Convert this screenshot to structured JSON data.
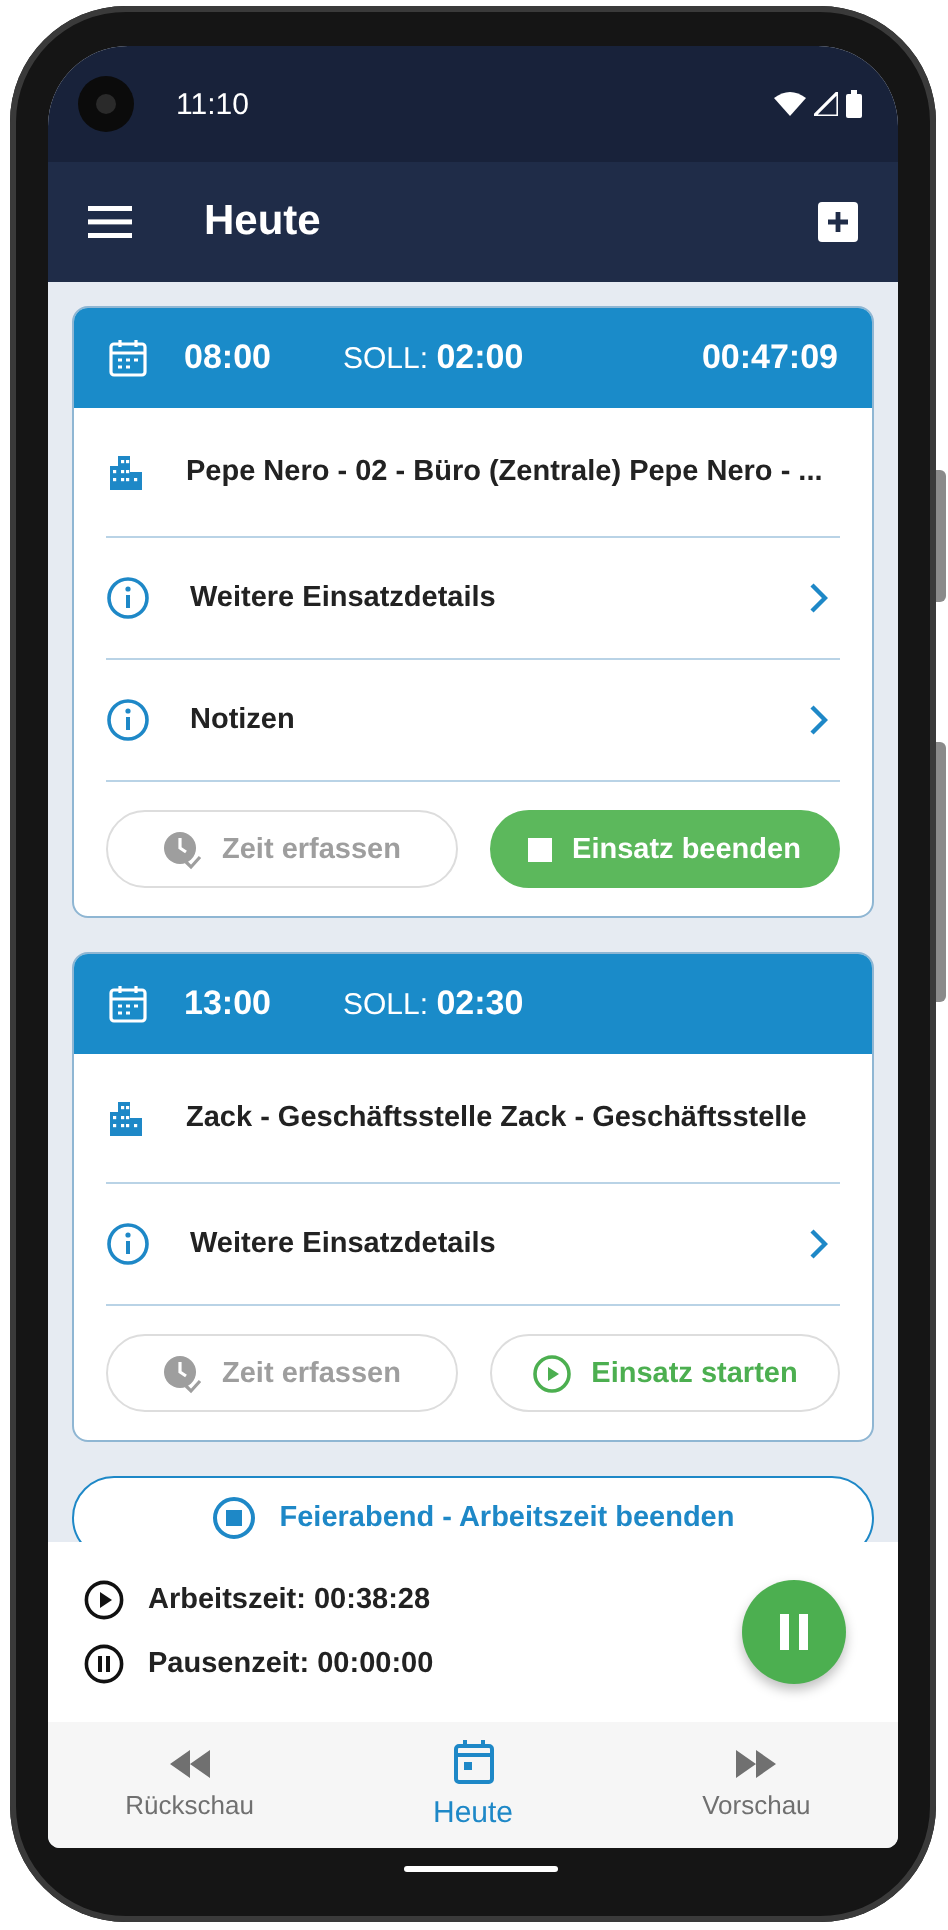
{
  "status_bar": {
    "time": "11:10"
  },
  "app_bar": {
    "title": "Heute"
  },
  "cards": [
    {
      "time": "08:00",
      "soll_label": "SOLL:",
      "soll_value": "02:00",
      "elapsed": "00:47:09",
      "location": "Pepe Nero - 02 - Büro (Zentrale) Pepe Nero - ...",
      "rows": [
        "Weitere Einsatzdetails",
        "Notizen"
      ],
      "buttons": [
        {
          "label": "Zeit erfassen",
          "kind": "record",
          "disabled": true
        },
        {
          "label": "Einsatz beenden",
          "kind": "stop",
          "disabled": false
        }
      ]
    },
    {
      "time": "13:00",
      "soll_label": "SOLL:",
      "soll_value": "02:30",
      "location": "Zack - Geschäftsstelle Zack - Geschäftsstelle",
      "rows": [
        "Weitere Einsatzdetails"
      ],
      "buttons": [
        {
          "label": "Zeit erfassen",
          "kind": "record",
          "disabled": true
        },
        {
          "label": "Einsatz starten",
          "kind": "start",
          "disabled": false
        }
      ]
    }
  ],
  "end_day_button": "Feierabend - Arbeitszeit beenden",
  "timers": [
    {
      "kind": "play",
      "label": "Arbeitszeit: 00:38:28"
    },
    {
      "kind": "pause",
      "label": "Pausenzeit: 00:00:00"
    }
  ],
  "bottom_nav": [
    {
      "label": "Rückschau",
      "kind": "rewind",
      "selected": false
    },
    {
      "label": "Heute",
      "kind": "calendar",
      "selected": true
    },
    {
      "label": "Vorschau",
      "kind": "forward",
      "selected": false
    }
  ]
}
